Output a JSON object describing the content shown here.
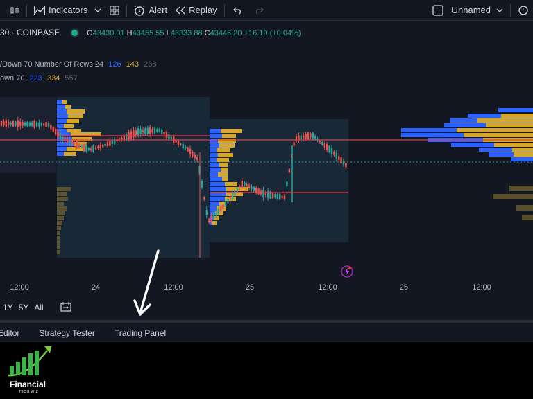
{
  "toolbar": {
    "indicators_label": "Indicators",
    "alert_label": "Alert",
    "replay_label": "Replay",
    "layout_name": "Unnamed"
  },
  "legend": {
    "symbol": "30 · COINBASE",
    "open_label": "O",
    "open_value": "43430.01",
    "high_label": "H",
    "high_value": "43455.55",
    "low_label": "L",
    "low_value": "43333.88",
    "close_label": "C",
    "close_value": "43446.20",
    "change": "+16.19 (+0.04%)",
    "indicator1_name": "/Down 70 Number Of Rows 24",
    "indicator1_v1": "126",
    "indicator1_v2": "143",
    "indicator1_v3": "268",
    "indicator2_name": "own 70",
    "indicator2_v1": "223",
    "indicator2_v2": "334",
    "indicator2_v3": "557"
  },
  "xaxis": {
    "labels": [
      "12:00",
      "24",
      "12:00",
      "25",
      "12:00",
      "26",
      "12:00"
    ]
  },
  "range_buttons": [
    "1Y",
    "5Y",
    "All"
  ],
  "bottom_tabs": [
    "Editor",
    "Strategy Tester",
    "Trading Panel"
  ],
  "logo": {
    "title": "Financial",
    "subtitle": "TECH WIZ"
  },
  "colors": {
    "background": "#131722",
    "up": "#26a69a",
    "down": "#ef5350",
    "profile_up": "#2962ff",
    "profile_down": "#d4a72c",
    "poc_line": "#f23645",
    "text": "#d1d4dc"
  }
}
